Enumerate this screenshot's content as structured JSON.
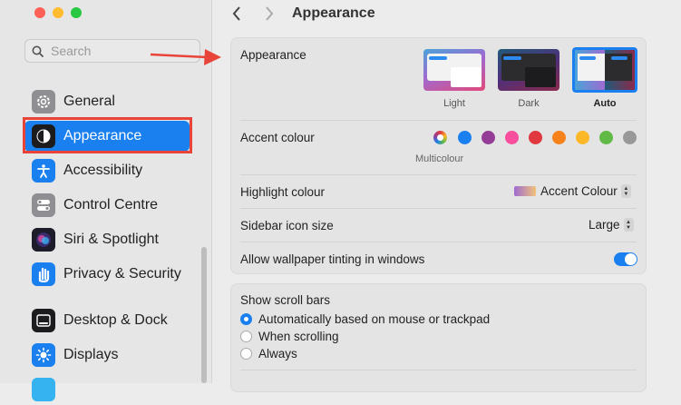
{
  "sidebar": {
    "search_placeholder": "Search",
    "items": [
      {
        "label": "General",
        "icon": "gear-icon"
      },
      {
        "label": "Appearance",
        "icon": "appearance-icon"
      },
      {
        "label": "Accessibility",
        "icon": "accessibility-icon"
      },
      {
        "label": "Control Centre",
        "icon": "control-centre-icon"
      },
      {
        "label": "Siri & Spotlight",
        "icon": "siri-icon"
      },
      {
        "label": "Privacy & Security",
        "icon": "hand-icon"
      },
      {
        "label": "Desktop & Dock",
        "icon": "dock-icon"
      },
      {
        "label": "Displays",
        "icon": "sun-icon"
      }
    ]
  },
  "header": {
    "title": "Appearance",
    "back": "<",
    "forward": ">"
  },
  "appearance": {
    "label": "Appearance",
    "options": [
      {
        "label": "Light",
        "selected": false
      },
      {
        "label": "Dark",
        "selected": false
      },
      {
        "label": "Auto",
        "selected": true
      }
    ]
  },
  "accent": {
    "label": "Accent colour",
    "caption": "Multicolour",
    "colors": [
      "multicolour",
      "#1a80f0",
      "#953d96",
      "#f74f9e",
      "#e0383e",
      "#f7821b",
      "#fcb827",
      "#62ba46",
      "#989898"
    ]
  },
  "highlight": {
    "label": "Highlight colour",
    "value": "Accent Colour"
  },
  "sidebar_icon": {
    "label": "Sidebar icon size",
    "value": "Large"
  },
  "tinting": {
    "label": "Allow wallpaper tinting in windows",
    "on": true
  },
  "scrollbars": {
    "label": "Show scroll bars",
    "options": [
      {
        "label": "Automatically based on mouse or trackpad",
        "checked": true
      },
      {
        "label": "When scrolling",
        "checked": false
      },
      {
        "label": "Always",
        "checked": false
      }
    ]
  }
}
